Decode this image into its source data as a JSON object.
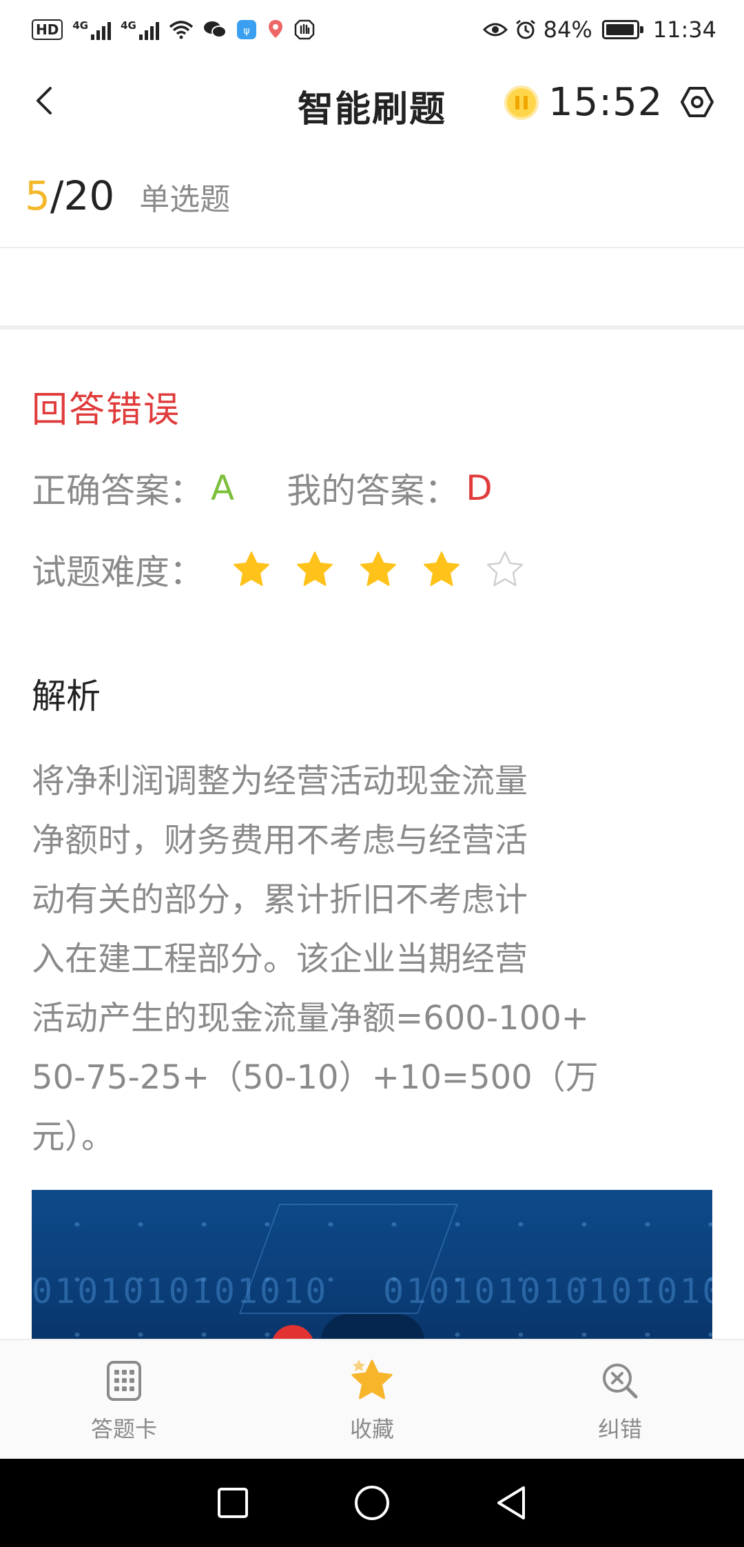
{
  "status_bar": {
    "hd": "HD",
    "network1": "4G",
    "network2": "4G",
    "battery_percent": "84%",
    "battery_level": 0.84,
    "time": "11:34",
    "icons": [
      "hd-icon",
      "signal-icon",
      "signal-icon",
      "wifi-icon",
      "wechat-icon",
      "app-notification-icon",
      "location-icon",
      "hand-icon",
      "eye-icon",
      "alarm-icon",
      "battery-icon"
    ]
  },
  "header": {
    "title": "智能刷题",
    "timer": "15:52",
    "back_icon": "chevron-left-icon",
    "pause_icon": "pause-icon",
    "settings_icon": "settings-hexagon-icon",
    "accent_color": "#f3b82b"
  },
  "progress": {
    "current": "5",
    "total": "/20",
    "question_type": "单选题"
  },
  "result": {
    "title": "回答错误",
    "correct_label": "正确答案：",
    "correct_value": "A",
    "mine_label": "我的答案：",
    "mine_value": "D",
    "difficulty_label": "试题难度：",
    "difficulty_stars": 4,
    "difficulty_max": 5,
    "error_color": "#e03b3b",
    "correct_color": "#7cbf3b"
  },
  "analysis": {
    "title": "解析",
    "lines": [
      "将净利润调整为经营活动现金流量",
      "净额时，财务费用不考虑与经营活",
      "动有关的部分，累计折旧不考虑计",
      "入在建工程部分。该企业当期经营",
      "活动产生的现金流量净额=600-100+",
      "50-75-25+（50-10）+10=500（万",
      "元）。"
    ]
  },
  "banner": {
    "binary_left": "0101010101010",
    "binary_right": "010101010101010"
  },
  "toolbar": {
    "items": [
      {
        "label": "答题卡",
        "icon": "answer-card-icon"
      },
      {
        "label": "收藏",
        "icon": "star-icon"
      },
      {
        "label": "纠错",
        "icon": "error-search-icon"
      }
    ]
  },
  "system_nav": {
    "icons": [
      "recent-apps-icon",
      "home-icon",
      "back-triangle-icon"
    ]
  }
}
